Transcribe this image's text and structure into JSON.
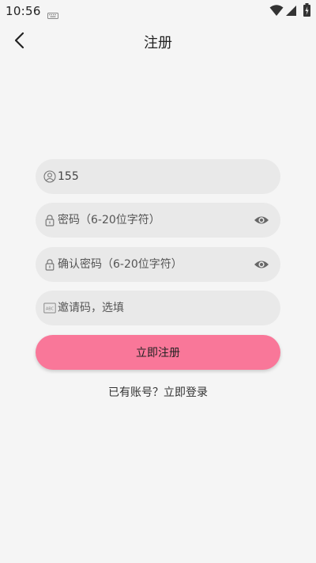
{
  "status_bar": {
    "time": "10:56"
  },
  "header": {
    "title": "注册"
  },
  "form": {
    "phone_value": "155",
    "password_placeholder": "密码（6-20位字符）",
    "confirm_placeholder": "确认密码（6-20位字符）",
    "invite_placeholder": "邀请码，选填",
    "submit_label": "立即注册",
    "login_prompt": "已有账号？立即登录"
  },
  "colors": {
    "accent": "#f97799",
    "field_bg": "#e9e9e9",
    "page_bg": "#f5f5f5"
  },
  "icons": [
    "keyboard-icon",
    "wifi-icon",
    "signal-icon",
    "battery-icon",
    "back-arrow-icon",
    "user-icon",
    "lock-icon",
    "eye-icon",
    "abc-icon"
  ]
}
